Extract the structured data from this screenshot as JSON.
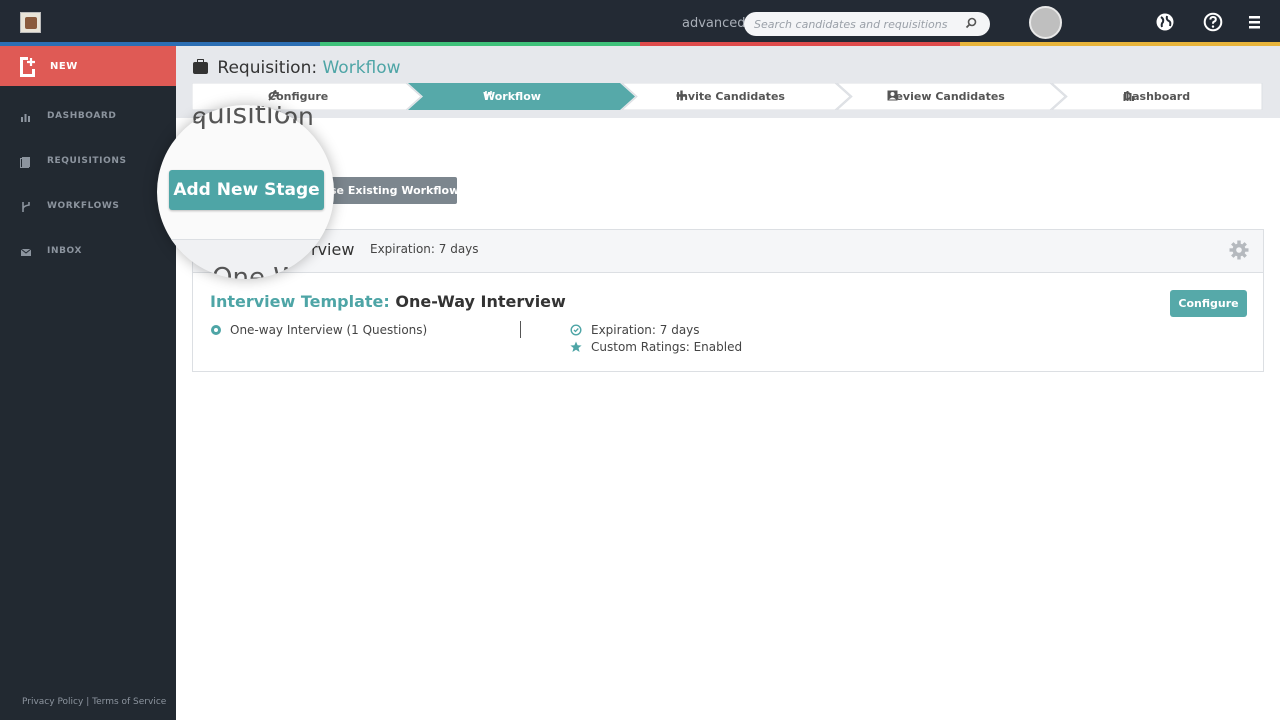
{
  "topbar": {
    "mode_label": "advanced",
    "search_placeholder": "Search candidates and requisitions",
    "icons": [
      "app-logo",
      "search-icon",
      "avatar",
      "globe-icon",
      "help-icon",
      "menu-icon"
    ],
    "progress_colors": [
      "#2c6fb4",
      "#3fc17a",
      "#df4b4b",
      "#e8b43a"
    ]
  },
  "sidebar": {
    "new_label": "NEW",
    "items": [
      {
        "label": "DASHBOARD",
        "icon": "bar-chart-icon"
      },
      {
        "label": "REQUISITIONS",
        "icon": "document-icon"
      },
      {
        "label": "WORKFLOWS",
        "icon": "branch-icon"
      },
      {
        "label": "INBOX",
        "icon": "envelope-icon"
      }
    ],
    "footer": {
      "privacy": "Privacy Policy",
      "separator": "|",
      "terms": "Terms of Service"
    }
  },
  "page": {
    "title_prefix": "Requisition:",
    "title_accent": "Workflow",
    "bg_heading": "equisition"
  },
  "steps": [
    {
      "label": "Configure",
      "icon": "wrench-icon",
      "active": false
    },
    {
      "label": "Workflow",
      "icon": "branch-icon",
      "active": true
    },
    {
      "label": "Invite Candidates",
      "icon": "plus-icon",
      "active": false
    },
    {
      "label": "Review Candidates",
      "icon": "person-icon",
      "active": false
    },
    {
      "label": "Dashboard",
      "icon": "bar-chart-icon",
      "active": false
    }
  ],
  "actions": {
    "add_stage": "Add New Stage",
    "use_existing": "se Existing Workflow"
  },
  "stage": {
    "name": "rview",
    "expiration": "Expiration: 7 days",
    "template_prefix": "Interview Template:",
    "template_name": "One-Way Interview",
    "configure": "Configure",
    "type_text": "One-way Interview (1 Questions)",
    "meta_expiration": "Expiration: 7 days",
    "meta_ratings": "Custom Ratings: Enabled"
  },
  "magnifier": {
    "top_text": "equisition",
    "bottom_text": "One-W"
  },
  "colors": {
    "accent": "#4ea5a6",
    "new_button": "#df5a55",
    "sidebar": "#222931"
  }
}
